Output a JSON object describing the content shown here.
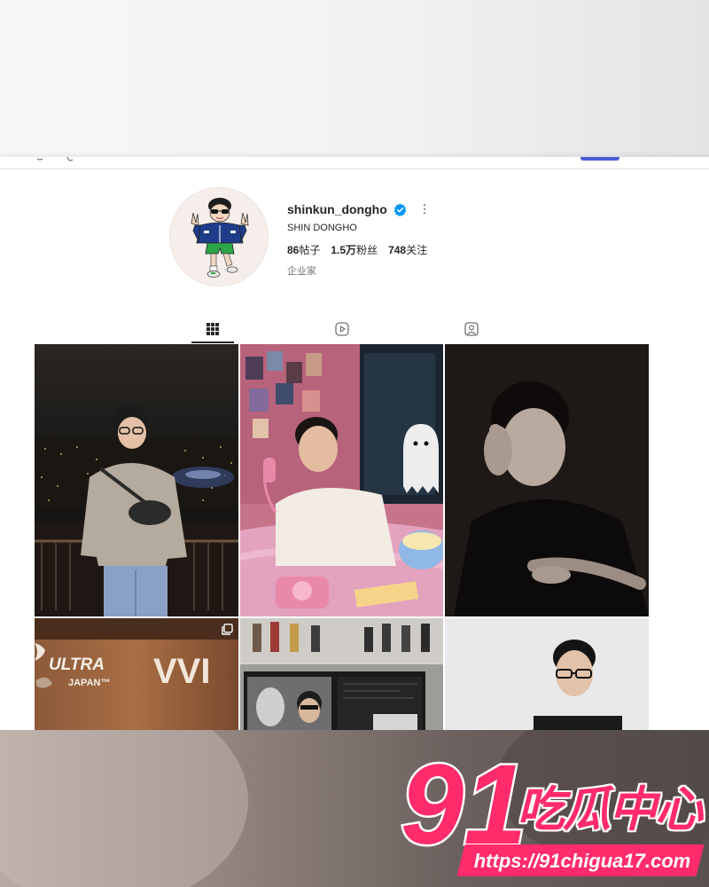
{
  "profile": {
    "username": "shinkun_dongho",
    "full_name": "SHIN DONGHO",
    "verified": true,
    "stats": {
      "posts_count": "86",
      "posts_label": "帖子",
      "followers_count": "1.5万",
      "followers_label": "粉丝",
      "following_count": "748",
      "following_label": "关注"
    },
    "category": "企业家"
  },
  "tabs": [
    {
      "name": "posts",
      "icon": "grid-icon",
      "active": true
    },
    {
      "name": "reels",
      "icon": "reels-icon",
      "active": false
    },
    {
      "name": "tagged",
      "icon": "tagged-icon",
      "active": false
    }
  ],
  "grid": {
    "posts": [
      {
        "description_icon": "photo"
      },
      {
        "description_icon": "photo"
      },
      {
        "description_icon": "photo"
      },
      {
        "description_icon": "photo",
        "text": "ULTRA",
        "subtext": "JAPAN™",
        "side_text": "VVI"
      },
      {
        "description_icon": "photo"
      },
      {
        "description_icon": "photo"
      }
    ]
  },
  "watermark": {
    "number": "91",
    "title": "吃瓜中心",
    "url": "https://91chigua17.com"
  },
  "colors": {
    "accent": "#ff2b6a",
    "verified": "#0095f6",
    "text": "#262626",
    "muted": "#737373"
  }
}
